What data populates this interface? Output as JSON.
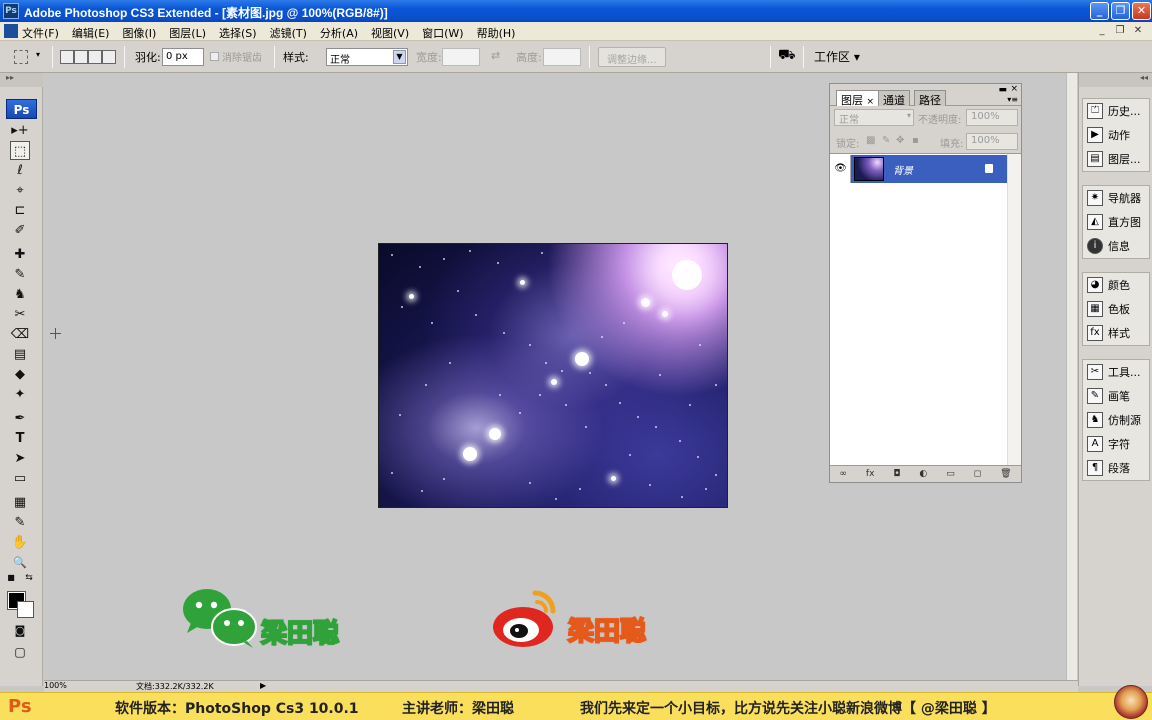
{
  "window": {
    "title": "Adobe Photoshop CS3 Extended - [素材图.jpg @ 100%(RGB/8#)]",
    "app_icon": "Ps",
    "buttons": [
      "_",
      "❐",
      "✕"
    ]
  },
  "menu": {
    "items": [
      "文件(F)",
      "编辑(E)",
      "图像(I)",
      "图层(L)",
      "选择(S)",
      "滤镜(T)",
      "分析(A)",
      "视图(V)",
      "窗口(W)",
      "帮助(H)"
    ]
  },
  "options": {
    "feather_label": "羽化:",
    "feather_value": "0 px",
    "antialias_label": "消除锯齿",
    "style_label": "样式:",
    "style_value": "正常",
    "width_label": "宽度:",
    "height_label": "高度:",
    "refine_edge": "调整边缘...",
    "workspace_label": "工作区"
  },
  "toolbox": {
    "logo": "Ps",
    "tools": [
      "▸+",
      "⬚",
      "ℓ",
      "⌖",
      "⊏",
      "✐",
      "✚",
      "✎",
      "♞",
      "✂",
      "⌫",
      "▤",
      "◆",
      "✦",
      "✒",
      "T",
      "➤",
      "▭",
      "▦",
      "✎",
      "✋",
      "🔍"
    ]
  },
  "layers_panel": {
    "tabs": [
      "图层",
      "通道",
      "路径"
    ],
    "blend_mode": "正常",
    "opacity_label": "不透明度:",
    "opacity_value": "100%",
    "lock_label": "锁定:",
    "fill_label": "填充:",
    "fill_value": "100%",
    "layer_name": "背景"
  },
  "dock": {
    "group1": [
      {
        "icon": "history-icon",
        "label": "历史..."
      },
      {
        "icon": "actions-icon",
        "label": "动作"
      },
      {
        "icon": "layers-icon",
        "label": "图层..."
      }
    ],
    "group2": [
      {
        "icon": "navigator-icon",
        "label": "导航器"
      },
      {
        "icon": "histogram-icon",
        "label": "直方图"
      },
      {
        "icon": "info-icon",
        "label": "信息"
      }
    ],
    "group3": [
      {
        "icon": "color-icon",
        "label": "颜色"
      },
      {
        "icon": "swatches-icon",
        "label": "色板"
      },
      {
        "icon": "styles-icon",
        "label": "样式"
      }
    ],
    "group4": [
      {
        "icon": "tool-presets-icon",
        "label": "工具..."
      },
      {
        "icon": "brushes-icon",
        "label": "画笔"
      },
      {
        "icon": "clone-source-icon",
        "label": "仿制源"
      },
      {
        "icon": "character-icon",
        "label": "字符"
      },
      {
        "icon": "paragraph-icon",
        "label": "段落"
      }
    ]
  },
  "status": {
    "zoom": "100%",
    "doc_info": "文档:332.2K/332.2K"
  },
  "watermark": {
    "wechat_name": "梁田聪",
    "weibo_name": "梁田聪"
  },
  "banner": {
    "ps_mark": "Ps",
    "version": "软件版本：PhotoShop Cs3 10.0.1",
    "teacher": "主讲老师：梁田聪",
    "slogan": "我们先来定一个小目标，比方说先关注小聪新浪微博【 @梁田聪 】"
  },
  "colors": {
    "title_bar": "#0a56d8",
    "selected_layer": "#3b5fbf",
    "banner_bg": "#f9df5b",
    "wechat_green": "#2fa23a",
    "weibo_red": "#e0271f"
  }
}
